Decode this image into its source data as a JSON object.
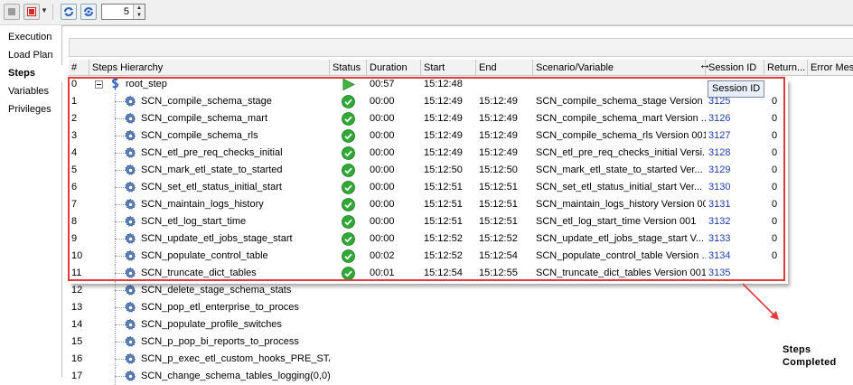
{
  "toolbar": {
    "spinner_value": "5",
    "icons": [
      "stop-gray-icon",
      "stop-red-icon",
      "refresh-icon",
      "auto-refresh-icon"
    ]
  },
  "nav": {
    "items": [
      {
        "label": "Execution"
      },
      {
        "label": "Load Plan"
      },
      {
        "label": "Steps",
        "active": true
      },
      {
        "label": "Variables"
      },
      {
        "label": "Privileges"
      }
    ]
  },
  "grid": {
    "headers": {
      "num": "#",
      "name": "Steps Hierarchy",
      "status": "Status",
      "duration": "Duration",
      "start": "Start",
      "end": "End",
      "scenario": "Scenario/Variable",
      "session": "Session ID",
      "return": "Return...",
      "error": "Error Mes"
    },
    "root": {
      "num": "0",
      "name": "root_step",
      "status": "running",
      "duration": "00:57",
      "start": "15:12:48"
    },
    "rows": [
      {
        "num": "1",
        "name": "SCN_compile_schema_stage",
        "status": "success",
        "duration": "00:00",
        "start": "15:12:49",
        "end": "15:12:49",
        "scenario": "SCN_compile_schema_stage Version ...",
        "session": "3125",
        "ret": "0"
      },
      {
        "num": "2",
        "name": "SCN_compile_schema_mart",
        "status": "success",
        "duration": "00:00",
        "start": "15:12:49",
        "end": "15:12:49",
        "scenario": "SCN_compile_schema_mart Version ...",
        "session": "3126",
        "ret": "0"
      },
      {
        "num": "3",
        "name": "SCN_compile_schema_rls",
        "status": "success",
        "duration": "00:00",
        "start": "15:12:49",
        "end": "15:12:49",
        "scenario": "SCN_compile_schema_rls Version 001",
        "session": "3127",
        "ret": "0"
      },
      {
        "num": "4",
        "name": "SCN_etl_pre_req_checks_initial",
        "status": "success",
        "duration": "00:00",
        "start": "15:12:49",
        "end": "15:12:49",
        "scenario": "SCN_etl_pre_req_checks_initial Versi...",
        "session": "3128",
        "ret": "0"
      },
      {
        "num": "5",
        "name": "SCN_mark_etl_state_to_started",
        "status": "success",
        "duration": "00:00",
        "start": "15:12:50",
        "end": "15:12:50",
        "scenario": "SCN_mark_etl_state_to_started Ver...",
        "session": "3129",
        "ret": "0"
      },
      {
        "num": "6",
        "name": "SCN_set_etl_status_initial_start",
        "status": "success",
        "duration": "00:00",
        "start": "15:12:51",
        "end": "15:12:51",
        "scenario": "SCN_set_etl_status_initial_start Ver...",
        "session": "3130",
        "ret": "0"
      },
      {
        "num": "7",
        "name": "SCN_maintain_logs_history",
        "status": "success",
        "duration": "00:00",
        "start": "15:12:51",
        "end": "15:12:51",
        "scenario": "SCN_maintain_logs_history Version 001",
        "session": "3131",
        "ret": "0"
      },
      {
        "num": "8",
        "name": "SCN_etl_log_start_time",
        "status": "success",
        "duration": "00:00",
        "start": "15:12:51",
        "end": "15:12:51",
        "scenario": "SCN_etl_log_start_time Version 001",
        "session": "3132",
        "ret": "0"
      },
      {
        "num": "9",
        "name": "SCN_update_etl_jobs_stage_start",
        "status": "success",
        "duration": "00:00",
        "start": "15:12:52",
        "end": "15:12:52",
        "scenario": "SCN_update_etl_jobs_stage_start V...",
        "session": "3133",
        "ret": "0"
      },
      {
        "num": "10",
        "name": "SCN_populate_control_table",
        "status": "success",
        "duration": "00:02",
        "start": "15:12:52",
        "end": "15:12:54",
        "scenario": "SCN_populate_control_table Version ...",
        "session": "3134",
        "ret": "0"
      },
      {
        "num": "11",
        "name": "SCN_truncate_dict_tables",
        "status": "success",
        "duration": "00:01",
        "start": "15:12:54",
        "end": "15:12:55",
        "scenario": "SCN_truncate_dict_tables Version 001",
        "session": "3135",
        "ret": ""
      },
      {
        "num": "12",
        "name": "SCN_delete_stage_schema_stats",
        "status": "",
        "duration": "",
        "start": "",
        "end": "",
        "scenario": "",
        "session": "",
        "ret": ""
      },
      {
        "num": "13",
        "name": "SCN_pop_etl_enterprise_to_proces",
        "status": "",
        "duration": "",
        "start": "",
        "end": "",
        "scenario": "",
        "session": "",
        "ret": ""
      },
      {
        "num": "14",
        "name": "SCN_populate_profile_switches",
        "status": "",
        "duration": "",
        "start": "",
        "end": "",
        "scenario": "",
        "session": "",
        "ret": ""
      },
      {
        "num": "15",
        "name": "SCN_p_pop_bi_reports_to_process",
        "status": "",
        "duration": "",
        "start": "",
        "end": "",
        "scenario": "",
        "session": "",
        "ret": ""
      },
      {
        "num": "16",
        "name": "SCN_p_exec_etl_custom_hooks_PRE_STAG",
        "status": "",
        "duration": "",
        "start": "",
        "end": "",
        "scenario": "",
        "session": "",
        "ret": ""
      },
      {
        "num": "17",
        "name": "SCN_change_schema_tables_logging(0,0)",
        "status": "",
        "duration": "",
        "start": "",
        "end": "",
        "scenario": "",
        "session": "",
        "ret": ""
      }
    ]
  },
  "tooltip": "Session ID",
  "annotation": {
    "line1": "Steps",
    "line2": "Completed",
    "color": "#e23b3b"
  },
  "colors": {
    "success": "#2fa836",
    "running": "#3fb53f",
    "session_link": "#1f3fb0",
    "highlight_box": "#e23b3b"
  }
}
